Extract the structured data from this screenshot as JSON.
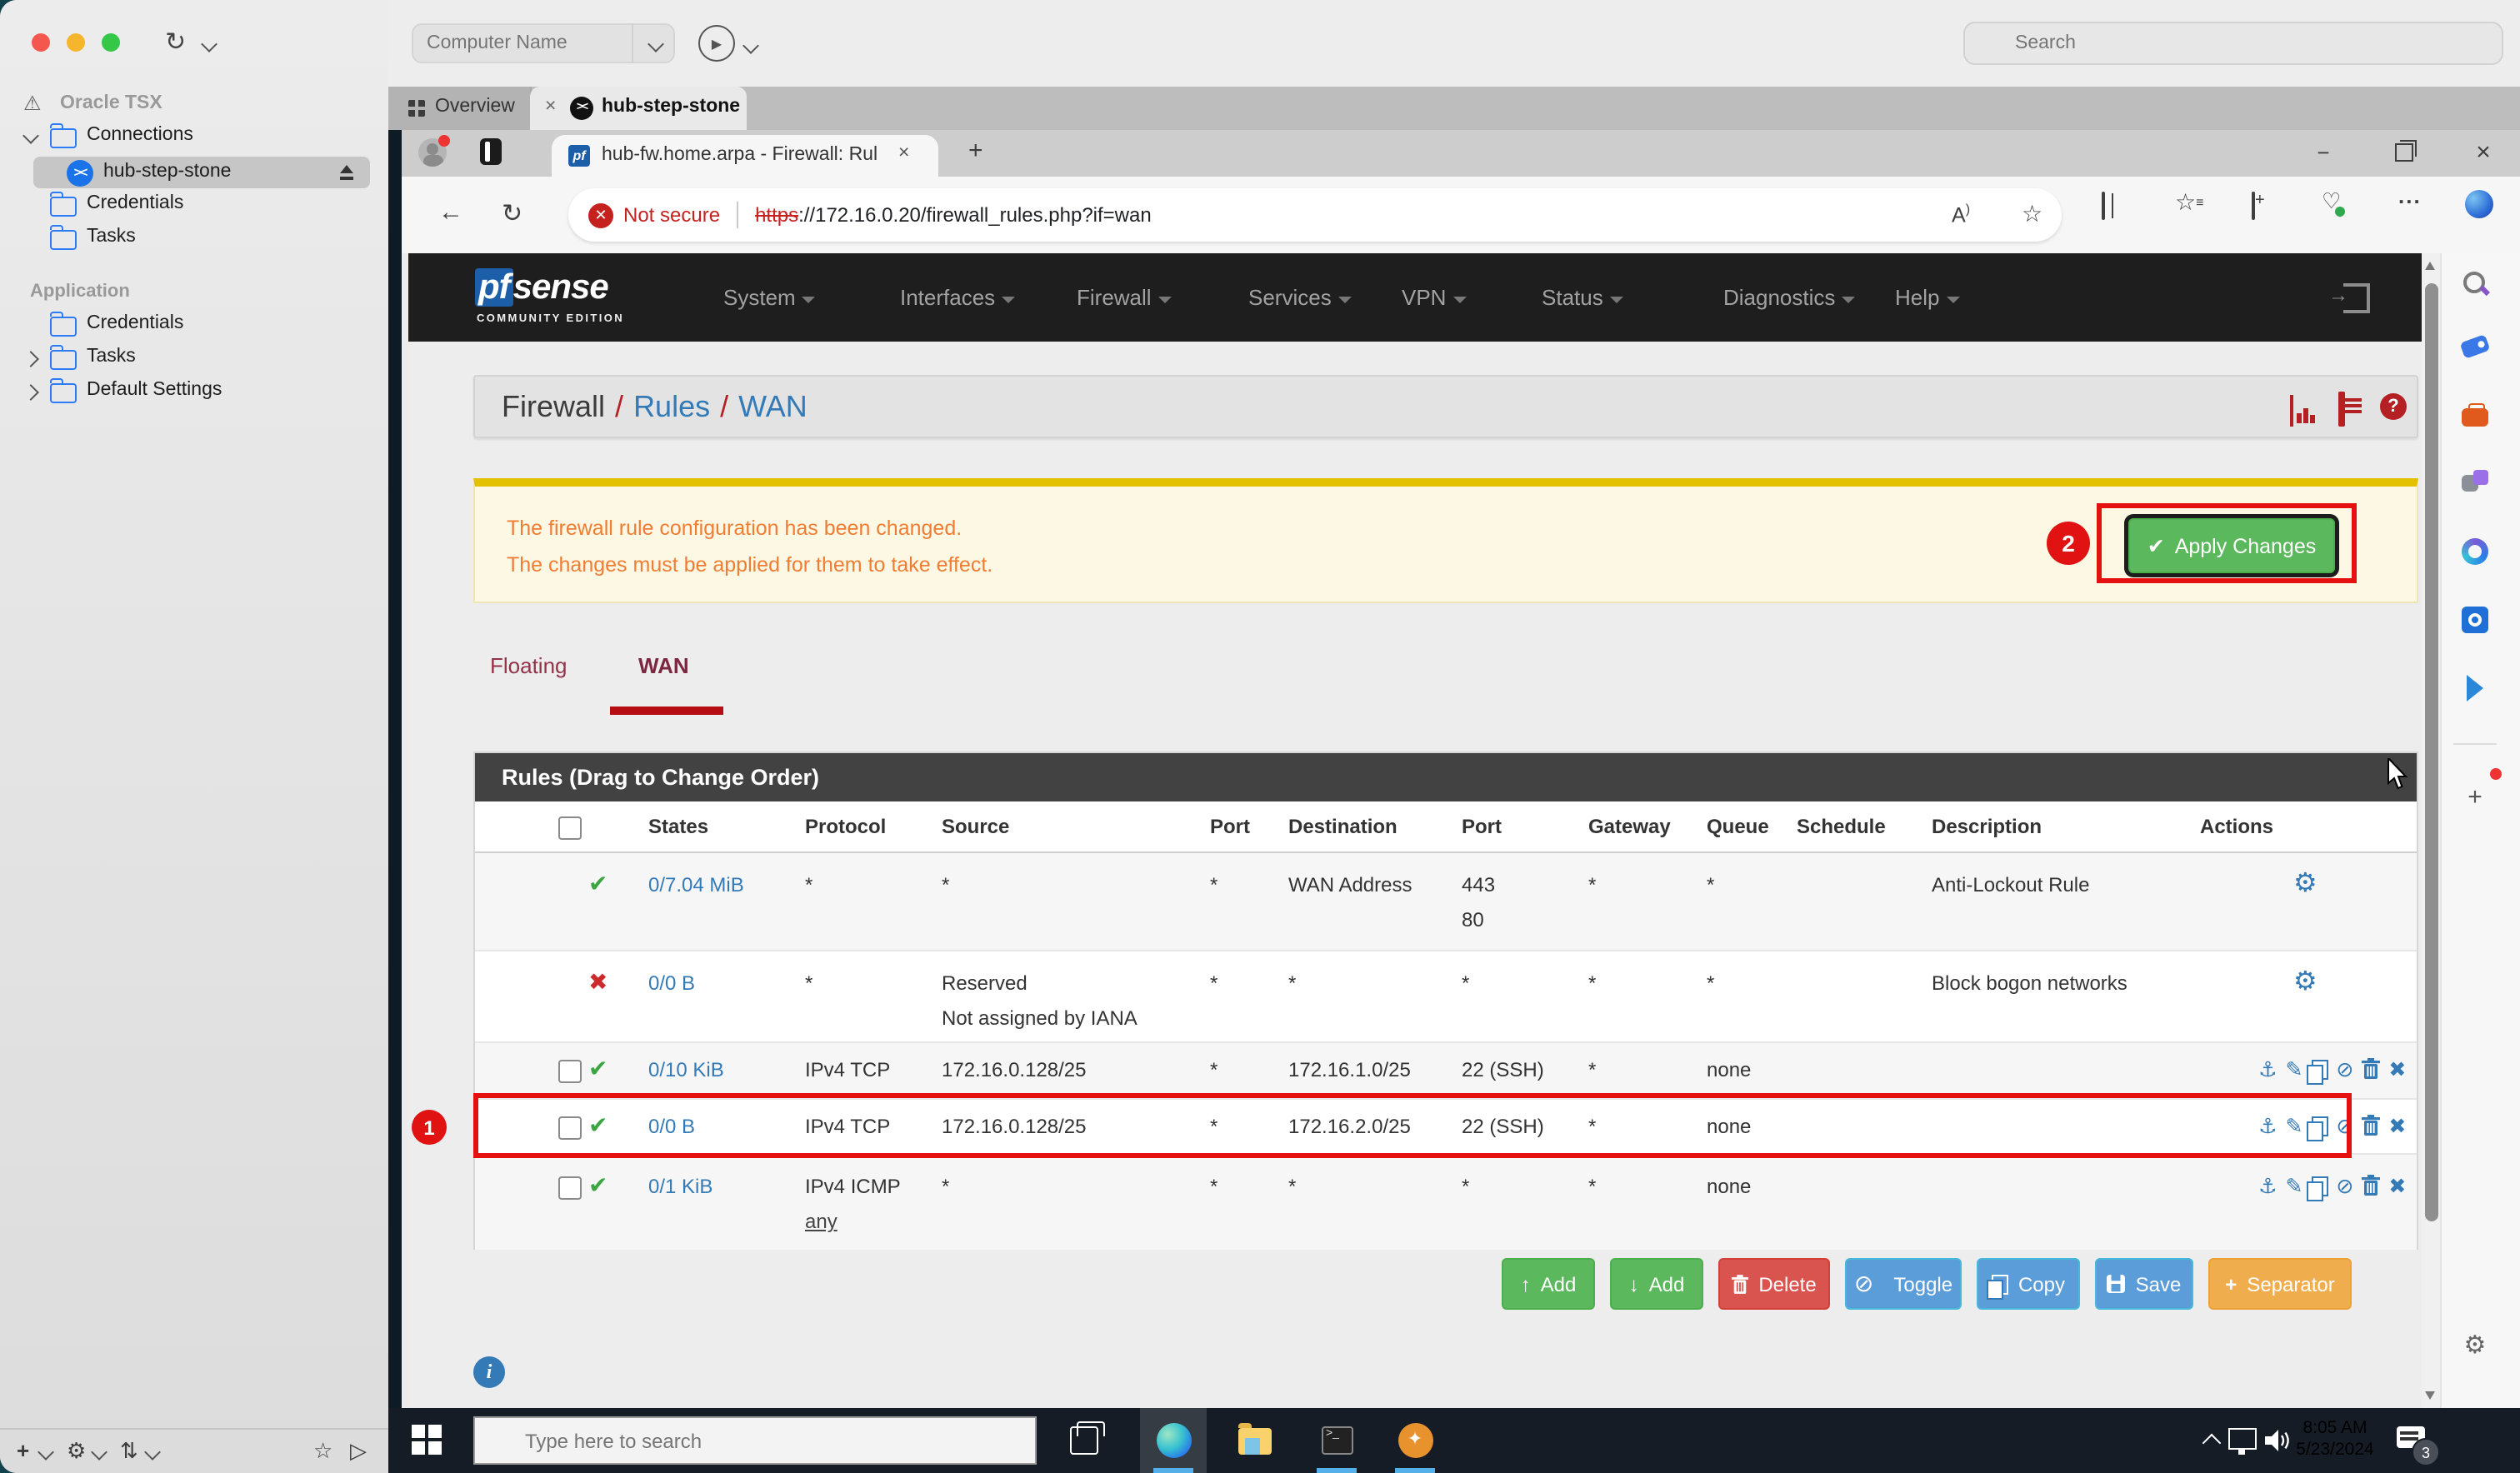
{
  "colors": {
    "annotation_red": "#e51010",
    "pfsense_link_blue": "#337ab7",
    "success_green": "#5cb85c",
    "danger_red": "#d9534f",
    "info_blue": "#5b9dd9",
    "separator_orange": "#f0ad4e",
    "alert_text_orange": "#ef7d33",
    "alert_bar_gold": "#e3c000",
    "pfsense_nav_bg": "#1e1e1e",
    "taskbar_bg": "#151c26"
  },
  "royal": {
    "toolbar": {
      "computer_name_placeholder": "Computer Name"
    },
    "search_placeholder": "Search",
    "tabs": {
      "overview": "Overview",
      "session": "hub-step-stone"
    },
    "sidebar": {
      "warning_item": "Oracle TSX",
      "connections_label": "Connections",
      "session_label": "hub-step-stone",
      "credentials_label": "Credentials",
      "tasks_label": "Tasks",
      "application_section": "Application",
      "app_credentials_label": "Credentials",
      "app_tasks_label": "Tasks",
      "default_settings_label": "Default Settings"
    }
  },
  "edge": {
    "tab_title": "hub-fw.home.arpa - Firewall: Rul",
    "address": {
      "security_badge": "Not secure",
      "scheme": "https",
      "rest": "://172.16.0.20/firewall_rules.php?if=wan"
    }
  },
  "pfsense": {
    "brand_pf": "pf",
    "brand_sense": "sense",
    "brand_edition": "COMMUNITY EDITION",
    "nav": [
      "System",
      "Interfaces",
      "Firewall",
      "Services",
      "VPN",
      "Status",
      "Diagnostics",
      "Help"
    ],
    "breadcrumb": {
      "a": "Firewall",
      "b": "Rules",
      "c": "WAN",
      "sep": "/"
    },
    "alert": {
      "line1": "The firewall rule configuration has been changed.",
      "line2": "The changes must be applied for them to take effect.",
      "apply_label": "Apply Changes"
    },
    "tabs": {
      "floating": "Floating",
      "wan": "WAN"
    },
    "panel_title": "Rules (Drag to Change Order)",
    "columns": {
      "states": "States",
      "protocol": "Protocol",
      "source": "Source",
      "port": "Port",
      "destination": "Destination",
      "port2": "Port",
      "gateway": "Gateway",
      "queue": "Queue",
      "schedule": "Schedule",
      "description": "Description",
      "actions": "Actions"
    },
    "rows": [
      {
        "states": "0/7.04 MiB",
        "protocol": "*",
        "protocol2": "",
        "source": "*",
        "source2": "",
        "port": "*",
        "destination": "WAN Address",
        "dport": "443",
        "dport2": "80",
        "gateway": "*",
        "queue": "*",
        "schedule": "",
        "description": "Anti-Lockout Rule"
      },
      {
        "states": "0/0 B",
        "protocol": "*",
        "protocol2": "",
        "source": "Reserved",
        "source2": "Not assigned by IANA",
        "port": "*",
        "destination": "*",
        "dport": "*",
        "dport2": "",
        "gateway": "*",
        "queue": "*",
        "schedule": "",
        "description": "Block bogon networks"
      },
      {
        "states": "0/10 KiB",
        "protocol": "IPv4 TCP",
        "protocol2": "",
        "source": "172.16.0.128/25",
        "source2": "",
        "port": "*",
        "destination": "172.16.1.0/25",
        "dport": "22 (SSH)",
        "dport2": "",
        "gateway": "*",
        "queue": "none",
        "schedule": "",
        "description": ""
      },
      {
        "states": "0/0 B",
        "protocol": "IPv4 TCP",
        "protocol2": "",
        "source": "172.16.0.128/25",
        "source2": "",
        "port": "*",
        "destination": "172.16.2.0/25",
        "dport": "22 (SSH)",
        "dport2": "",
        "gateway": "*",
        "queue": "none",
        "schedule": "",
        "description": ""
      },
      {
        "states": "0/1 KiB",
        "protocol": "IPv4 ICMP",
        "protocol2": "any",
        "source": "*",
        "source2": "",
        "port": "*",
        "destination": "*",
        "dport": "*",
        "dport2": "",
        "gateway": "*",
        "queue": "none",
        "schedule": "",
        "description": ""
      }
    ],
    "footer": {
      "add_up": "Add",
      "add_down": "Add",
      "delete": "Delete",
      "toggle": "Toggle",
      "copy": "Copy",
      "save": "Save",
      "separator": "Separator"
    }
  },
  "annotations": {
    "step1": "1",
    "step2": "2"
  },
  "windows": {
    "taskbar_search_placeholder": "Type here to search",
    "clock_time": "8:05 AM",
    "clock_date": "5/23/2024",
    "notification_count": "3"
  }
}
